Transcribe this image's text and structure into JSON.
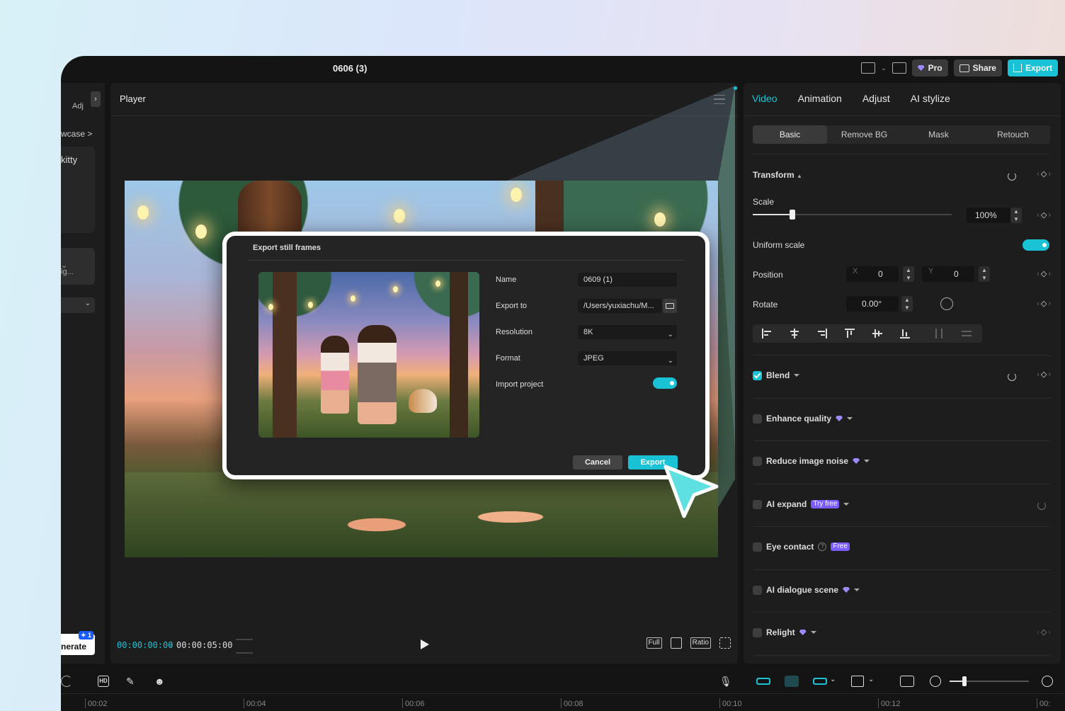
{
  "window": {
    "title": "0606 (3)"
  },
  "topbar": {
    "pro_label": "Pro",
    "share_label": "Share",
    "export_label": "Export"
  },
  "left_panel": {
    "adjust_label": "Adj",
    "showcase_label": "wcase >",
    "item_label": "kitty",
    "dropdown_label": "ig...",
    "generate_label": "nerate",
    "generate_badge": "✦ 1"
  },
  "player": {
    "title": "Player",
    "current_time": "00:00:00:00",
    "separator": "/",
    "total_time": "00:00:05:00",
    "full_label": "Full",
    "ratio_label": "Ratio"
  },
  "dialog": {
    "title": "Export still frames",
    "fields": {
      "name_label": "Name",
      "name_value": "0609 (1)",
      "export_to_label": "Export to",
      "export_to_value": "/Users/yuxiachu/M...",
      "resolution_label": "Resolution",
      "resolution_value": "8K",
      "format_label": "Format",
      "format_value": "JPEG",
      "import_label": "Import project",
      "import_on": true
    },
    "cancel_label": "Cancel",
    "export_label": "Export"
  },
  "right_panel": {
    "tabs": [
      "Video",
      "Animation",
      "Adjust",
      "AI stylize"
    ],
    "active_tab": "Video",
    "subtabs": [
      "Basic",
      "Remove BG",
      "Mask",
      "Retouch"
    ],
    "active_subtab": "Basic",
    "transform_label": "Transform",
    "scale_label": "Scale",
    "scale_value": "100%",
    "scale_fraction": 0.2,
    "uniform_scale_label": "Uniform scale",
    "uniform_scale_on": true,
    "position_label": "Position",
    "pos_x_label": "X",
    "pos_x": "0",
    "pos_y_label": "Y",
    "pos_y": "0",
    "rotate_label": "Rotate",
    "rotate_value": "0.00°",
    "features": {
      "blend": "Blend",
      "enhance": "Enhance quality",
      "noise": "Reduce image noise",
      "expand": "AI expand",
      "expand_badge": "Try free",
      "eye": "Eye contact",
      "eye_badge": "Free",
      "dialogue": "AI dialogue scene",
      "relight": "Relight"
    }
  },
  "timeline": {
    "ticks": [
      "00:02",
      "00:04",
      "00:06",
      "00:08",
      "00:10",
      "00:12",
      "00:"
    ]
  },
  "colors": {
    "accent": "#19c3d5",
    "pro_gem": "#9c8bff",
    "badge": "#7b5cff"
  }
}
